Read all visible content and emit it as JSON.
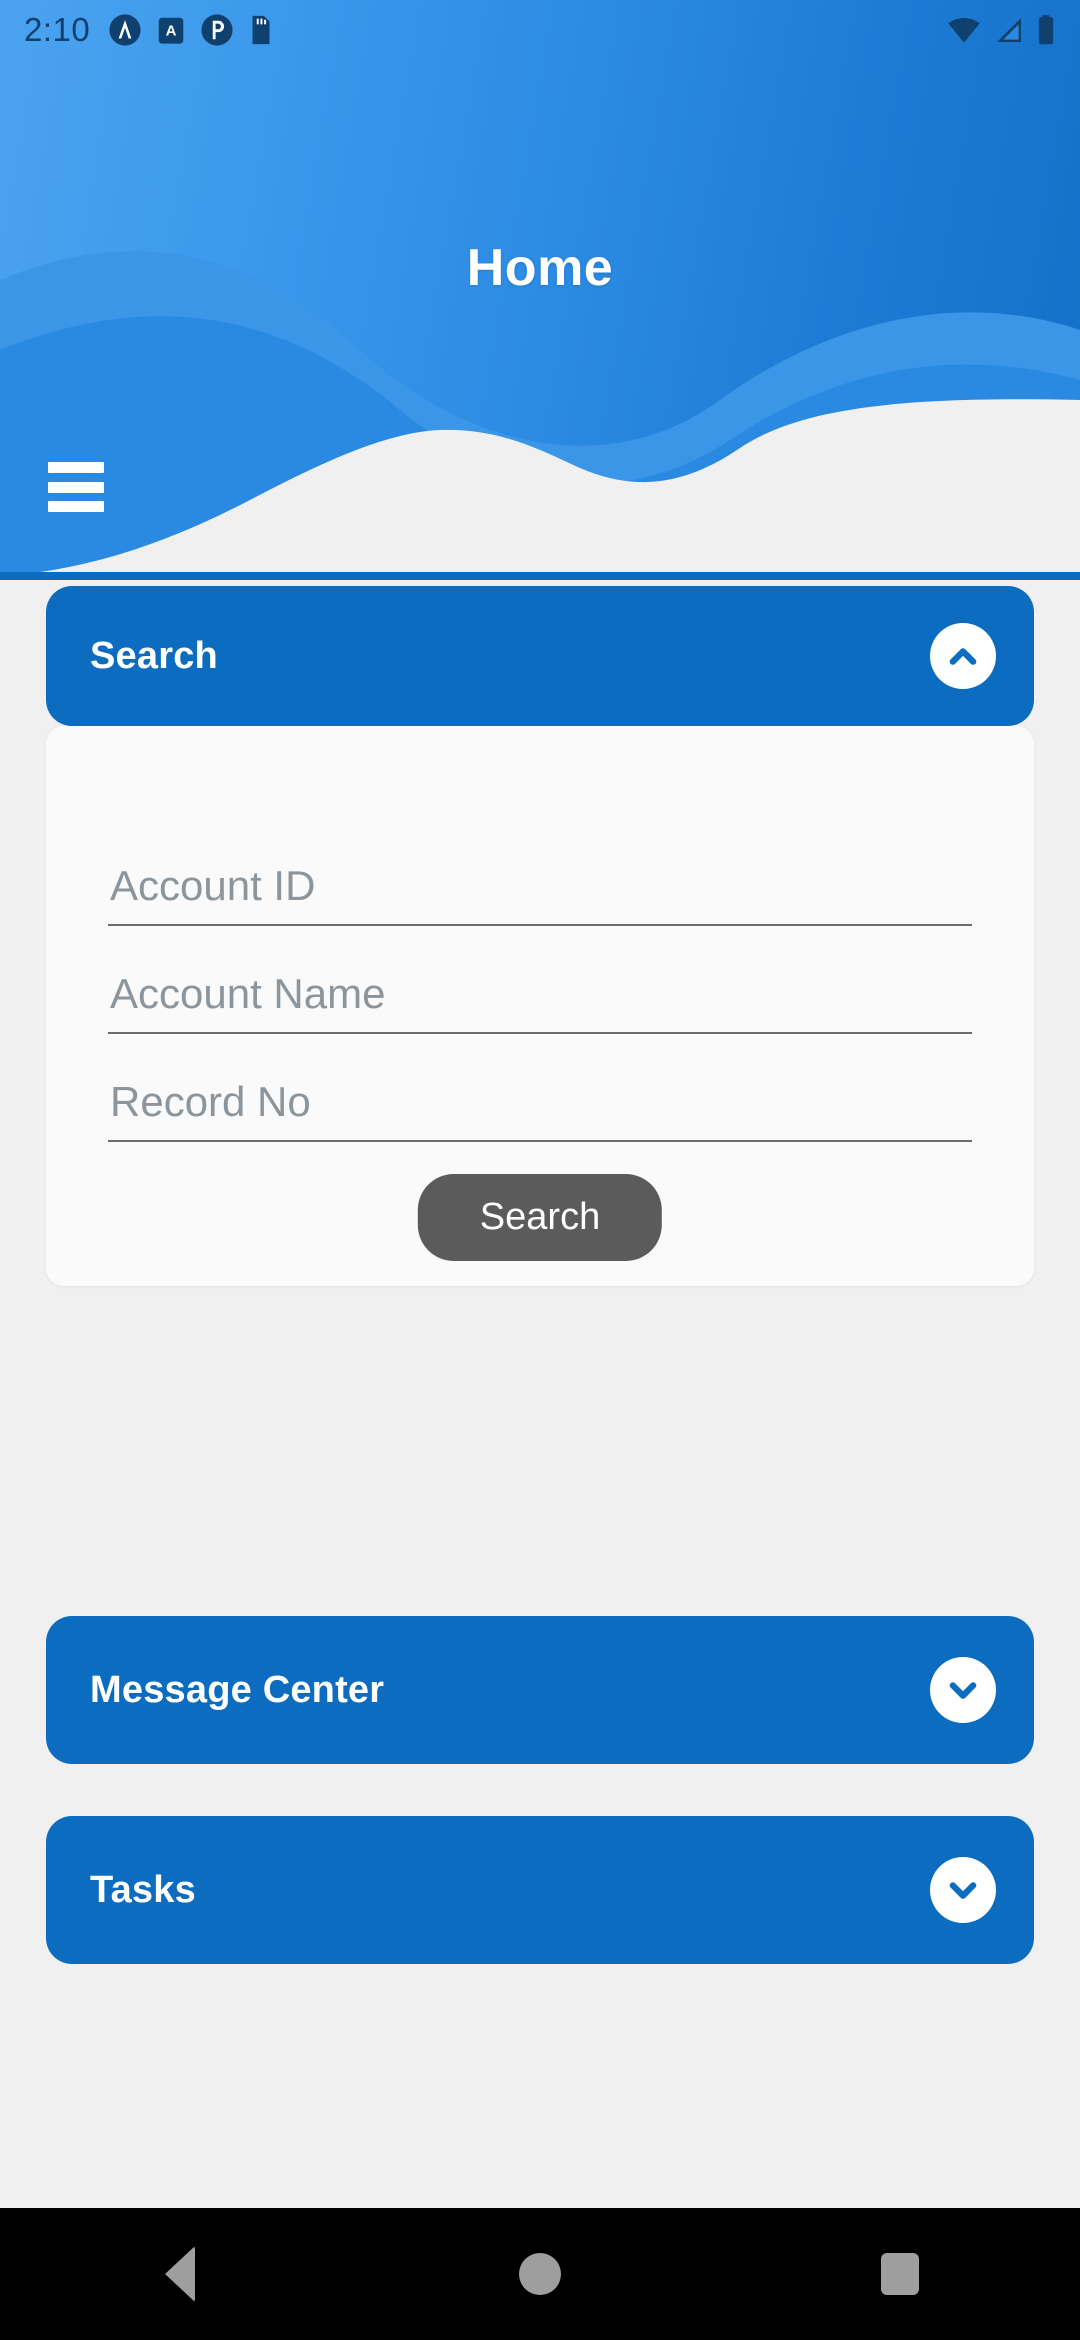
{
  "status_bar": {
    "time": "2:10",
    "left_icons": [
      "notification-circle-a-icon",
      "notification-square-a-icon",
      "notification-circle-p-icon",
      "sd-card-icon"
    ],
    "right_icons": [
      "wifi-icon",
      "cellular-signal-icon",
      "battery-icon"
    ]
  },
  "header": {
    "title": "Home",
    "menu_icon": "hamburger-menu-icon",
    "gradient_from": "#4aa3ef",
    "gradient_to": "#1470c6",
    "wave_light": "#3b96e8",
    "wave_mid": "#2a89e0",
    "wave_white": "#f0f0f0",
    "wave_deep": "#0c6cbf"
  },
  "theme": {
    "panel_blue": "#0c6cbf",
    "page_background": "#f0f0f0",
    "card_background": "#fafafa",
    "button_gray": "#5b5b5b"
  },
  "panels": [
    {
      "id": "search",
      "label": "Search",
      "expanded": true,
      "chevron": "chevron-up-icon"
    },
    {
      "id": "message_center",
      "label": "Message Center",
      "expanded": false,
      "chevron": "chevron-down-icon"
    },
    {
      "id": "tasks",
      "label": "Tasks",
      "expanded": false,
      "chevron": "chevron-down-icon"
    }
  ],
  "search_form": {
    "fields": [
      {
        "id": "account_id",
        "placeholder": "Account ID",
        "value": ""
      },
      {
        "id": "account_name",
        "placeholder": "Account Name",
        "value": ""
      },
      {
        "id": "record_no",
        "placeholder": "Record No",
        "value": ""
      }
    ],
    "submit_label": "Search"
  },
  "nav_bar": {
    "back_label": "Back",
    "home_label": "Home",
    "recents_label": "Recents",
    "icons": [
      "back-triangle-icon",
      "home-circle-icon",
      "recents-square-icon"
    ]
  }
}
